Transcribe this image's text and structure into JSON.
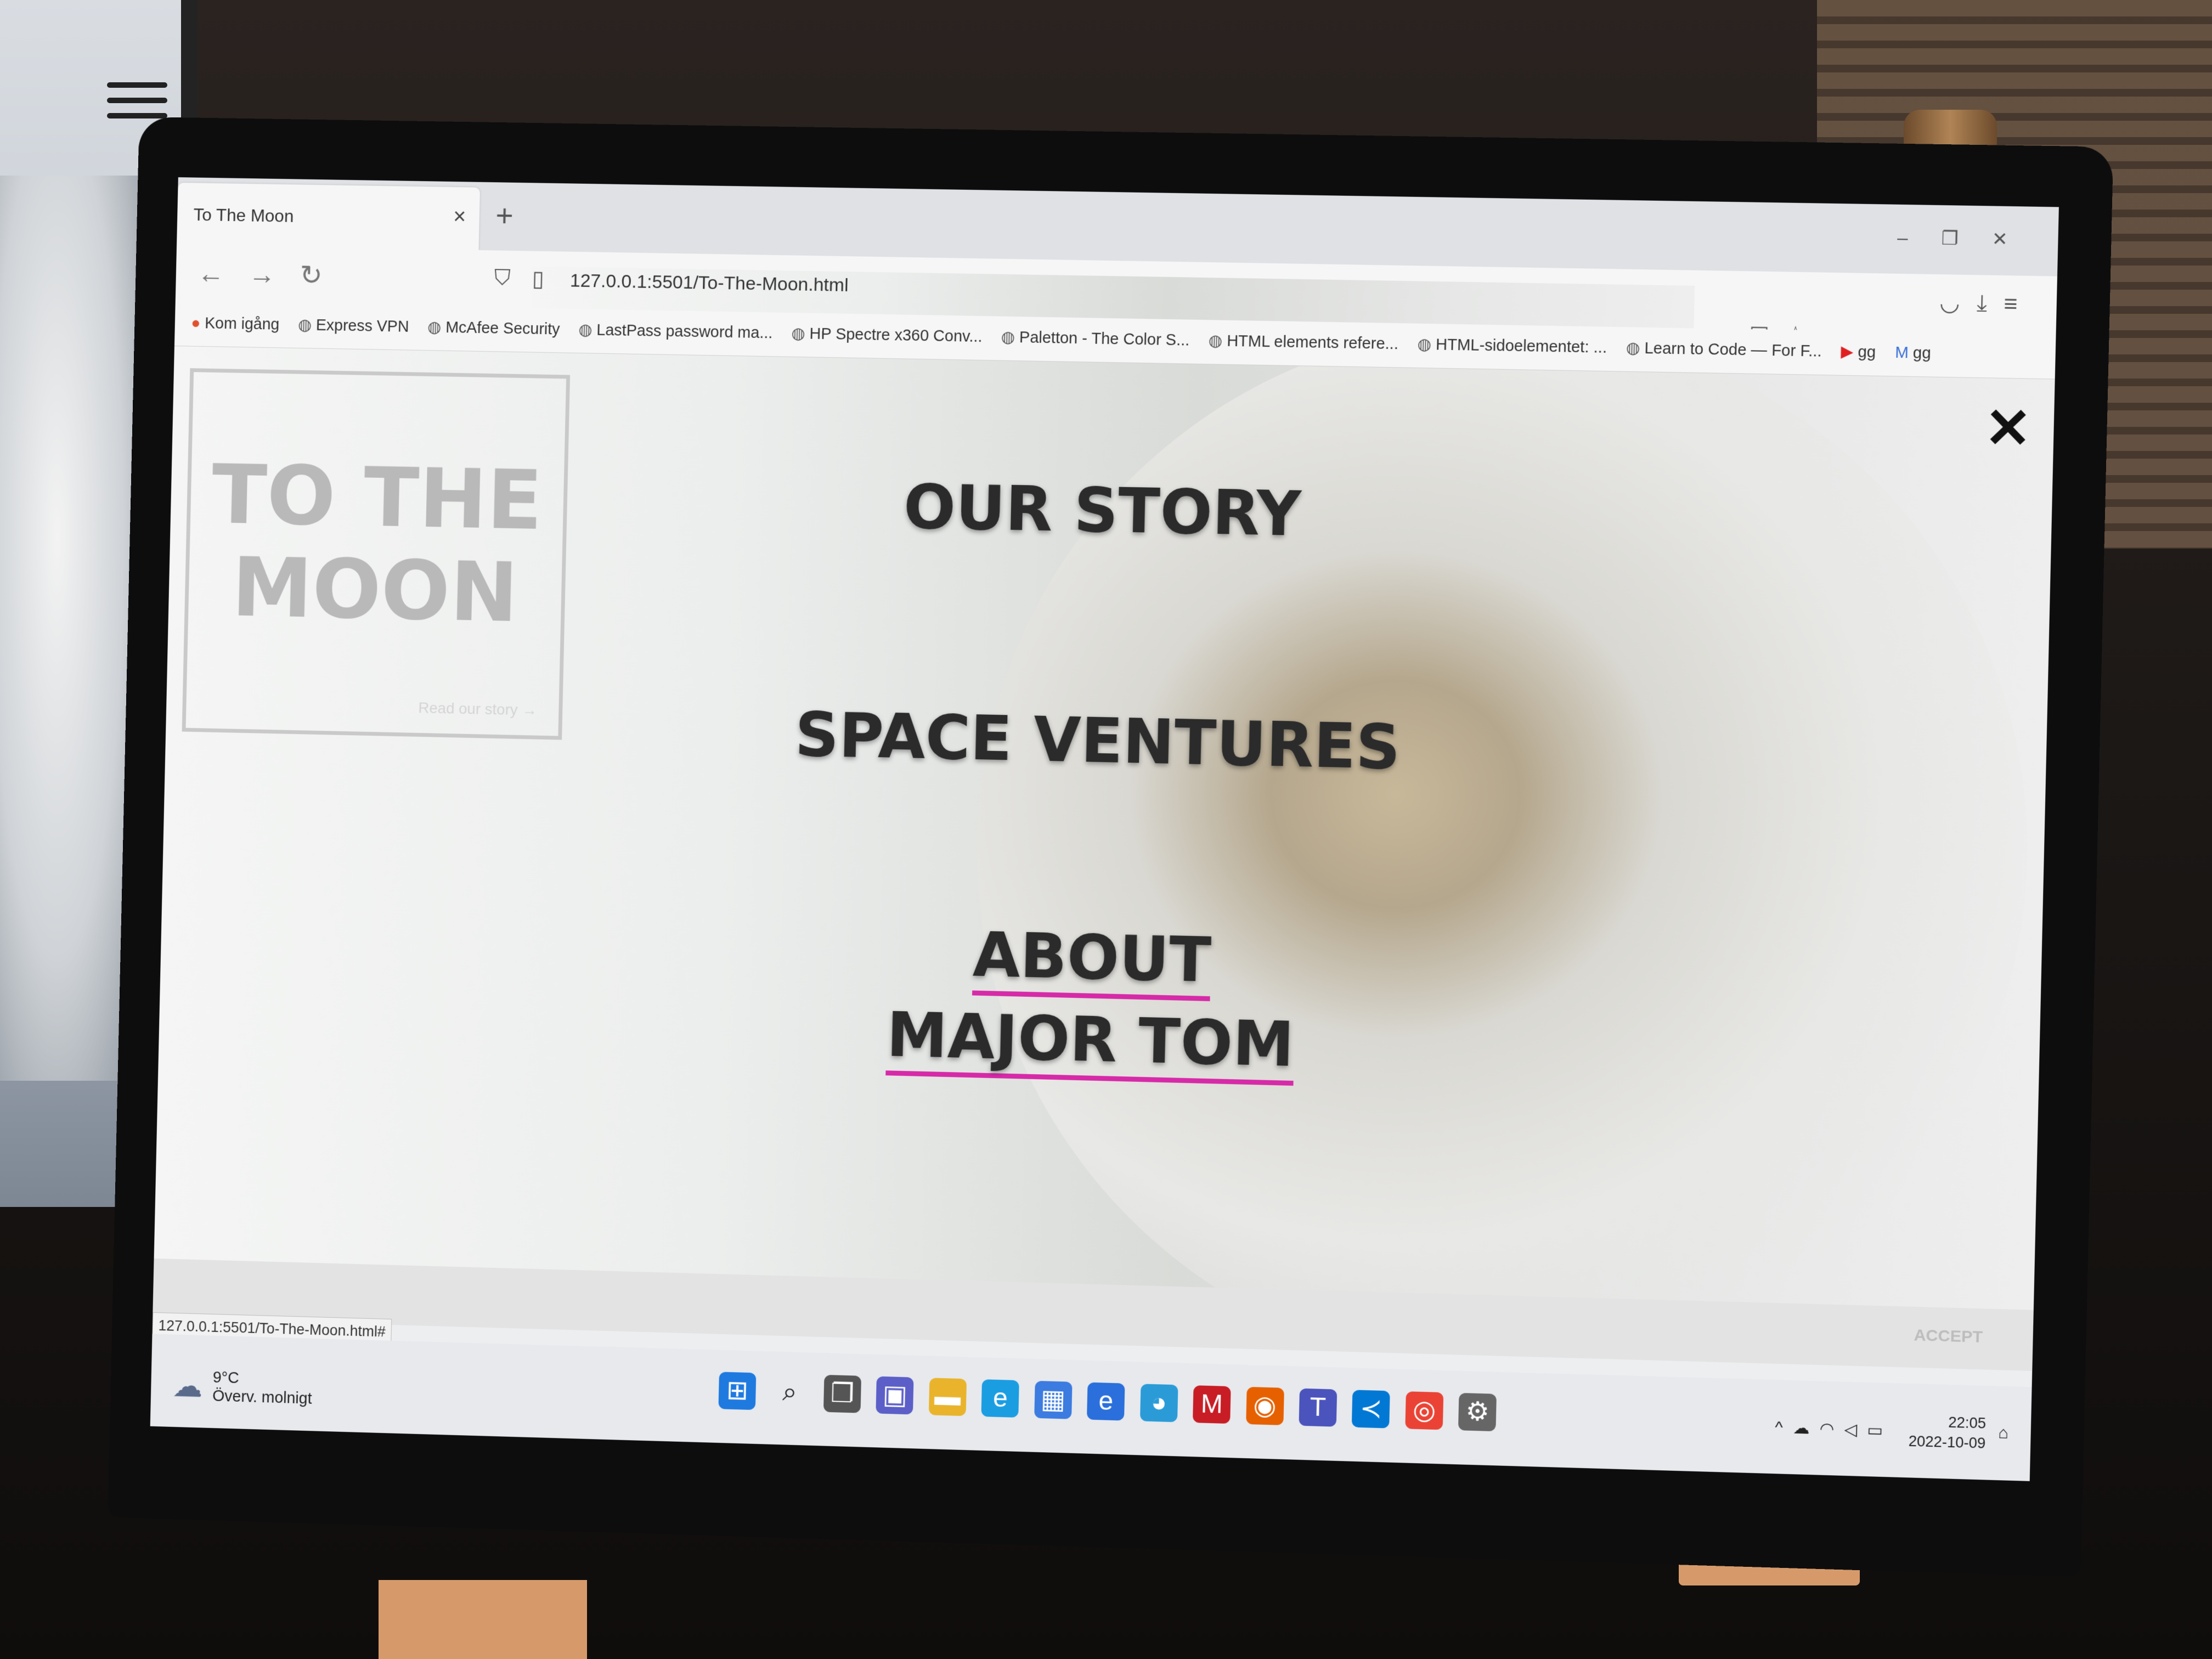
{
  "browser": {
    "tab_title": "To The Moon",
    "tab_close": "×",
    "new_tab": "+",
    "url": "127.0.0.1:5501/To-The-Moon.html",
    "status_url": "127.0.0.1:5501/To-The-Moon.html#"
  },
  "bookmarks": [
    "Kom igång",
    "Express VPN",
    "McAfee Security",
    "LastPass password ma...",
    "HP Spectre x360 Conv...",
    "Paletton - The Color S...",
    "HTML elements refere...",
    "HTML-sidoelementet: ...",
    "Learn to Code — For F...",
    "gg",
    "gg"
  ],
  "page": {
    "logo_line1": "TO THE",
    "logo_line2": "MOON",
    "logo_link": "Read our story →",
    "close": "✕",
    "menu": {
      "item1": "OUR STORY",
      "item2": "SPACE VENTURES",
      "item3_line1": "ABOUT",
      "item3_line2": "MAJOR TOM"
    },
    "accept": "ACCEPT",
    "accent_color": "#d62aa8"
  },
  "taskbar": {
    "temperature": "9°C",
    "weather": "Överv. molnigt",
    "time": "22:05",
    "date": "2022-10-09"
  }
}
